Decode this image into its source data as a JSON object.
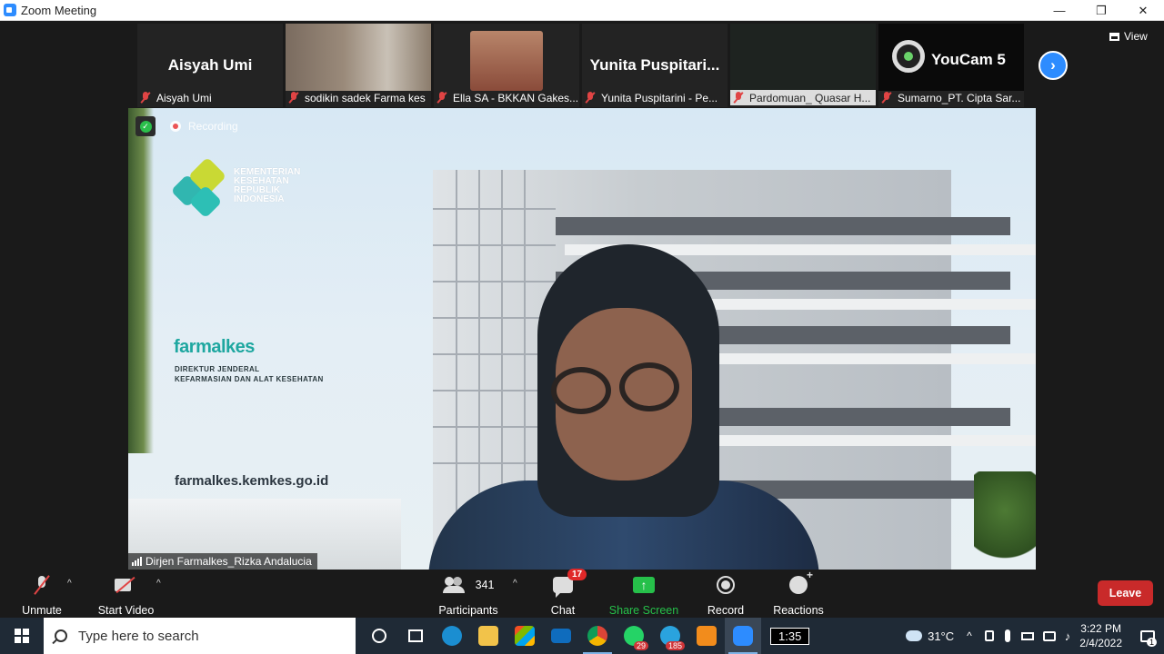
{
  "window": {
    "title": "Zoom Meeting",
    "minimize": "—",
    "restore": "❐",
    "close": "✕"
  },
  "strip": {
    "tiles": [
      {
        "big_name": "Aisyah Umi",
        "label": "Aisyah Umi",
        "kind": "name"
      },
      {
        "big_name": "",
        "label": "sodikin sadek Farma kes",
        "kind": "video"
      },
      {
        "big_name": "",
        "label": "Ella SA - BKKAN Gakes...",
        "kind": "video"
      },
      {
        "big_name": "Yunita  Puspitari...",
        "label": "Yunita Puspitarini - Pe...",
        "kind": "name"
      },
      {
        "big_name": "",
        "label": "Pardomuan_ Quasar H...",
        "kind": "video"
      },
      {
        "big_name": "YouCam 5",
        "label": "Sumarno_PT. Cipta Sar...",
        "kind": "youcam"
      }
    ],
    "next_icon": "›",
    "view_label": "View"
  },
  "main_video": {
    "recording_label": "Recording",
    "logo_text": [
      "KEMENTERIAN",
      "KESEHATAN",
      "REPUBLIK",
      "INDONESIA"
    ],
    "brand": "farmalkes",
    "brand_sub": [
      "DIREKTUR JENDERAL",
      "KEFARMASIAN DAN ALAT KESEHATAN"
    ],
    "website": "farmalkes.kemkes.go.id",
    "speaker_name": "Dirjen Farmalkes_Rizka Andalucia"
  },
  "toolbar": {
    "unmute": "Unmute",
    "start_video": "Start Video",
    "participants": "Participants",
    "participants_count": "341",
    "chat": "Chat",
    "chat_badge": "17",
    "share_screen": "Share Screen",
    "share_icon": "↑",
    "record": "Record",
    "reactions": "Reactions",
    "leave": "Leave",
    "caret": "^"
  },
  "taskbar": {
    "search_placeholder": "Type here to search",
    "whatsapp_badge": "29",
    "telegram_badge": "185",
    "timer": "1:35",
    "weather": "31°C",
    "time": "3:22 PM",
    "date": "2/4/2022",
    "notif_count": "1"
  },
  "colors": {
    "accent": "#2d8cff",
    "leave": "#c92a2a",
    "share": "#26c04a",
    "brand": "#1ea7a0"
  }
}
